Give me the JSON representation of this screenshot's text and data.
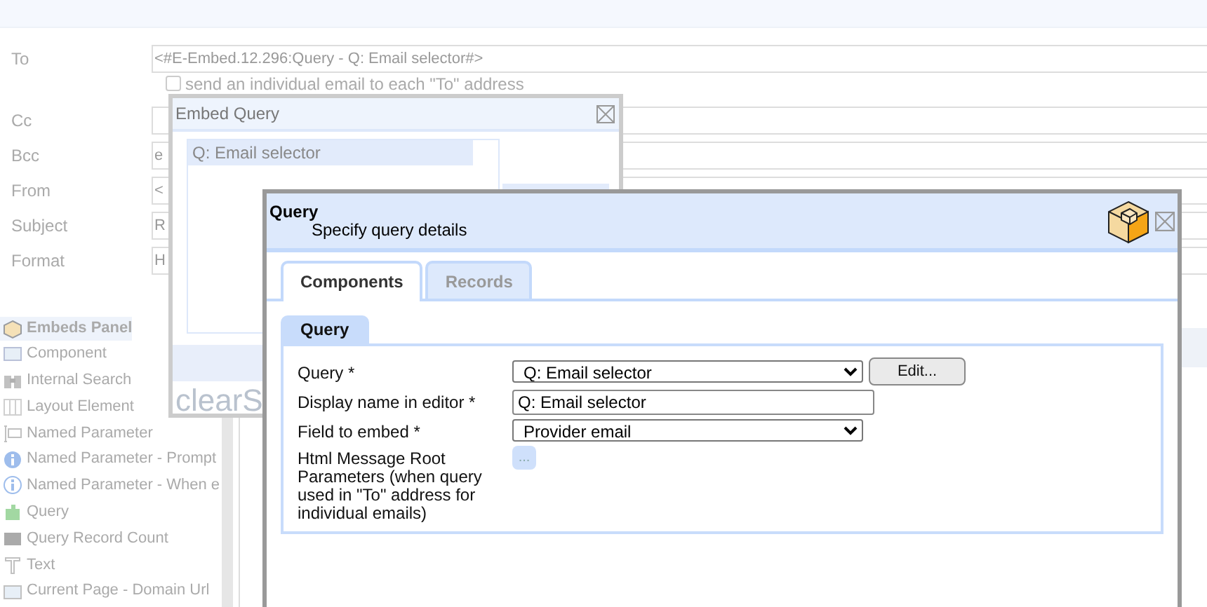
{
  "email_form": {
    "rows": [
      {
        "kind": "field",
        "label": "To",
        "value": "<#E-Embed.12.296:Query - Q: Email selector#>"
      },
      {
        "kind": "checkbox",
        "label": "send an individual email to each \"To\" address",
        "checked": false
      },
      {
        "kind": "field",
        "label": "Cc"
      },
      {
        "kind": "field",
        "label": "Bcc",
        "value": "e"
      },
      {
        "kind": "field",
        "label": "From",
        "value": "<"
      },
      {
        "kind": "field",
        "label": "Subject",
        "value": "R"
      },
      {
        "kind": "field",
        "label": "Format",
        "value": "H"
      }
    ]
  },
  "embeds_panel": {
    "title": "Embeds Panel",
    "items": [
      {
        "label": "Component"
      },
      {
        "label": "Internal Search"
      },
      {
        "label": "Layout Element"
      },
      {
        "label": "Named Parameter"
      },
      {
        "label": "Named Parameter - Prompt"
      },
      {
        "label": "Named Parameter - When e"
      },
      {
        "label": "Query"
      },
      {
        "label": "Query Record Count"
      },
      {
        "label": "Text"
      },
      {
        "label": "Current Page - Domain Url"
      }
    ]
  },
  "embed_dialog": {
    "title": "Embed Query",
    "list": [
      {
        "label": "Q: Email selector",
        "selected": true
      }
    ],
    "footer_text": "clearS"
  },
  "query_dialog": {
    "title": "Query",
    "subtitle": "Specify query details",
    "tabs": [
      {
        "label": "Components",
        "selected": true
      },
      {
        "label": "Records",
        "selected": false
      }
    ],
    "group": {
      "title": "Query",
      "rows": [
        {
          "kind": "select",
          "label": "Query *",
          "value": "Q: Email selector",
          "button": {
            "label": "Edit...",
            "disabled": false
          }
        },
        {
          "kind": "input",
          "label": "Display name in editor *",
          "value": "Q: Email selector"
        },
        {
          "kind": "select",
          "label": "Field to embed *",
          "value": "Provider email"
        },
        {
          "kind": "button",
          "label": "Html Message Root Parameters (when query used in \"To\" address for individual emails)",
          "button": {
            "label": "...",
            "disabled": true
          }
        }
      ]
    }
  }
}
